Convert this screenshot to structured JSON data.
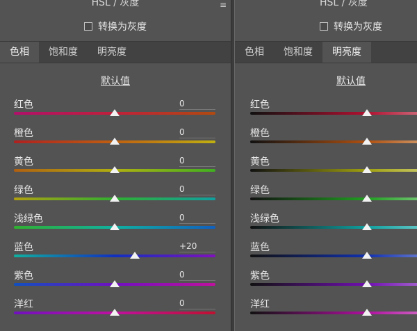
{
  "left": {
    "title": "HSL / 灰度",
    "gray_label": "转换为灰度",
    "tabs": [
      {
        "label": "色相",
        "active": true
      },
      {
        "label": "饱和度",
        "active": false
      },
      {
        "label": "明亮度",
        "active": false
      }
    ],
    "default_label": "默认值",
    "rows": [
      {
        "label": "红色",
        "value": "0",
        "fraction": 0.5,
        "colors": [
          "#b0106a",
          "#c0203a",
          "#b04a10"
        ]
      },
      {
        "label": "橙色",
        "value": "0",
        "fraction": 0.5,
        "colors": [
          "#b02020",
          "#c06010",
          "#c0b010"
        ]
      },
      {
        "label": "黄色",
        "value": "0",
        "fraction": 0.5,
        "colors": [
          "#b06010",
          "#b0b010",
          "#40b020"
        ]
      },
      {
        "label": "绿色",
        "value": "0",
        "fraction": 0.5,
        "colors": [
          "#b0a010",
          "#30b030",
          "#10a0a0"
        ]
      },
      {
        "label": "浅绿色",
        "value": "0",
        "fraction": 0.5,
        "colors": [
          "#30b030",
          "#10b0a0",
          "#1060c0"
        ]
      },
      {
        "label": "蓝色",
        "value": "+20",
        "fraction": 0.6,
        "colors": [
          "#10b0a0",
          "#1030c0",
          "#8010c0"
        ]
      },
      {
        "label": "紫色",
        "value": "0",
        "fraction": 0.5,
        "colors": [
          "#1050c0",
          "#7010c0",
          "#c010a0"
        ]
      },
      {
        "label": "洋红",
        "value": "0",
        "fraction": 0.5,
        "colors": [
          "#7010c0",
          "#c010a0",
          "#c01030"
        ]
      }
    ]
  },
  "right": {
    "title": "HSL / 灰度",
    "gray_label": "转换为灰度",
    "tabs": [
      {
        "label": "色相",
        "active": false
      },
      {
        "label": "饱和度",
        "active": false
      },
      {
        "label": "明亮度",
        "active": true
      }
    ],
    "default_label": "默认值",
    "rows": [
      {
        "label": "红色",
        "fraction": 0.5,
        "colors": [
          "#111111",
          "#b01030",
          "#f0d0d0"
        ]
      },
      {
        "label": "橙色",
        "fraction": 0.5,
        "colors": [
          "#111111",
          "#b05010",
          "#f0e0c0"
        ]
      },
      {
        "label": "黄色",
        "fraction": 0.5,
        "colors": [
          "#111111",
          "#a0a010",
          "#f0f0c0"
        ]
      },
      {
        "label": "绿色",
        "fraction": 0.5,
        "colors": [
          "#111111",
          "#20a020",
          "#d0f0d0"
        ]
      },
      {
        "label": "浅绿色",
        "fraction": 0.5,
        "colors": [
          "#111111",
          "#10a0a0",
          "#c0f0f0"
        ]
      },
      {
        "label": "蓝色",
        "fraction": 0.5,
        "colors": [
          "#111111",
          "#1030b0",
          "#c0c8f0"
        ]
      },
      {
        "label": "紫色",
        "fraction": 0.5,
        "colors": [
          "#111111",
          "#7010b0",
          "#e0c0f0"
        ]
      },
      {
        "label": "洋红",
        "fraction": 0.5,
        "colors": [
          "#111111",
          "#b010a0",
          "#f0c0e8"
        ]
      }
    ]
  }
}
